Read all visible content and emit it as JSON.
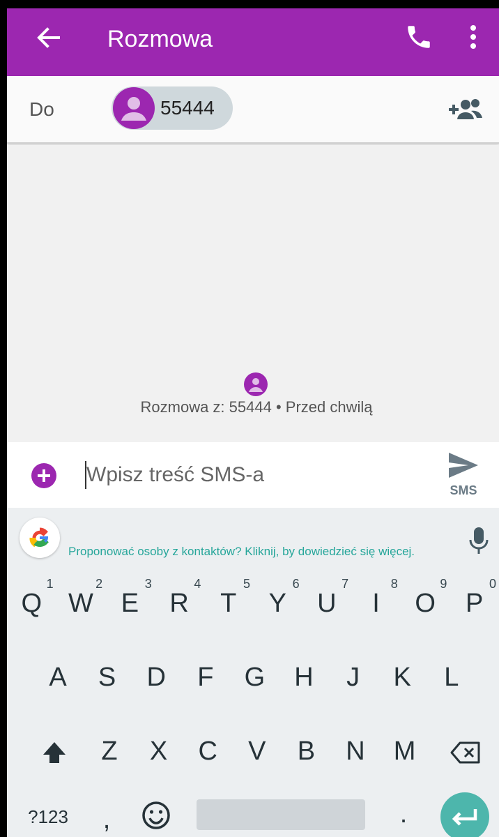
{
  "toolbar": {
    "title": "Rozmowa",
    "back_icon": "arrow-left-icon",
    "call_icon": "phone-icon",
    "menu_icon": "more-vert-icon",
    "color": "#9c27b0"
  },
  "recipient": {
    "to_label": "Do",
    "chip_number": "55444",
    "add_icon": "add-person-icon"
  },
  "conversation": {
    "info": "Rozmowa z: 55444 • Przed chwilą"
  },
  "compose": {
    "placeholder": "Wpisz treść SMS-a",
    "send_label": "SMS",
    "attach_icon": "add-circle-icon",
    "send_icon": "send-icon"
  },
  "suggestion": {
    "text": "Proponować osoby z kontaktów? Kliknij, by dowiedzieć się więcej.",
    "logo_icon": "google-g-icon",
    "mic_icon": "mic-icon"
  },
  "keyboard": {
    "row1": [
      {
        "key": "Q",
        "hint": "1"
      },
      {
        "key": "W",
        "hint": "2"
      },
      {
        "key": "E",
        "hint": "3"
      },
      {
        "key": "R",
        "hint": "4"
      },
      {
        "key": "T",
        "hint": "5"
      },
      {
        "key": "Y",
        "hint": "6"
      },
      {
        "key": "U",
        "hint": "7"
      },
      {
        "key": "I",
        "hint": "8"
      },
      {
        "key": "O",
        "hint": "9"
      },
      {
        "key": "P",
        "hint": "0"
      }
    ],
    "row2": [
      "A",
      "S",
      "D",
      "F",
      "G",
      "H",
      "J",
      "K",
      "L"
    ],
    "row3": [
      "Z",
      "X",
      "C",
      "V",
      "B",
      "N",
      "M"
    ],
    "symbols_label": "?123",
    "comma": ",",
    "period": ".",
    "shift_icon": "shift-icon",
    "backspace_icon": "backspace-icon",
    "emoji_icon": "emoji-icon",
    "enter_icon": "enter-icon"
  }
}
